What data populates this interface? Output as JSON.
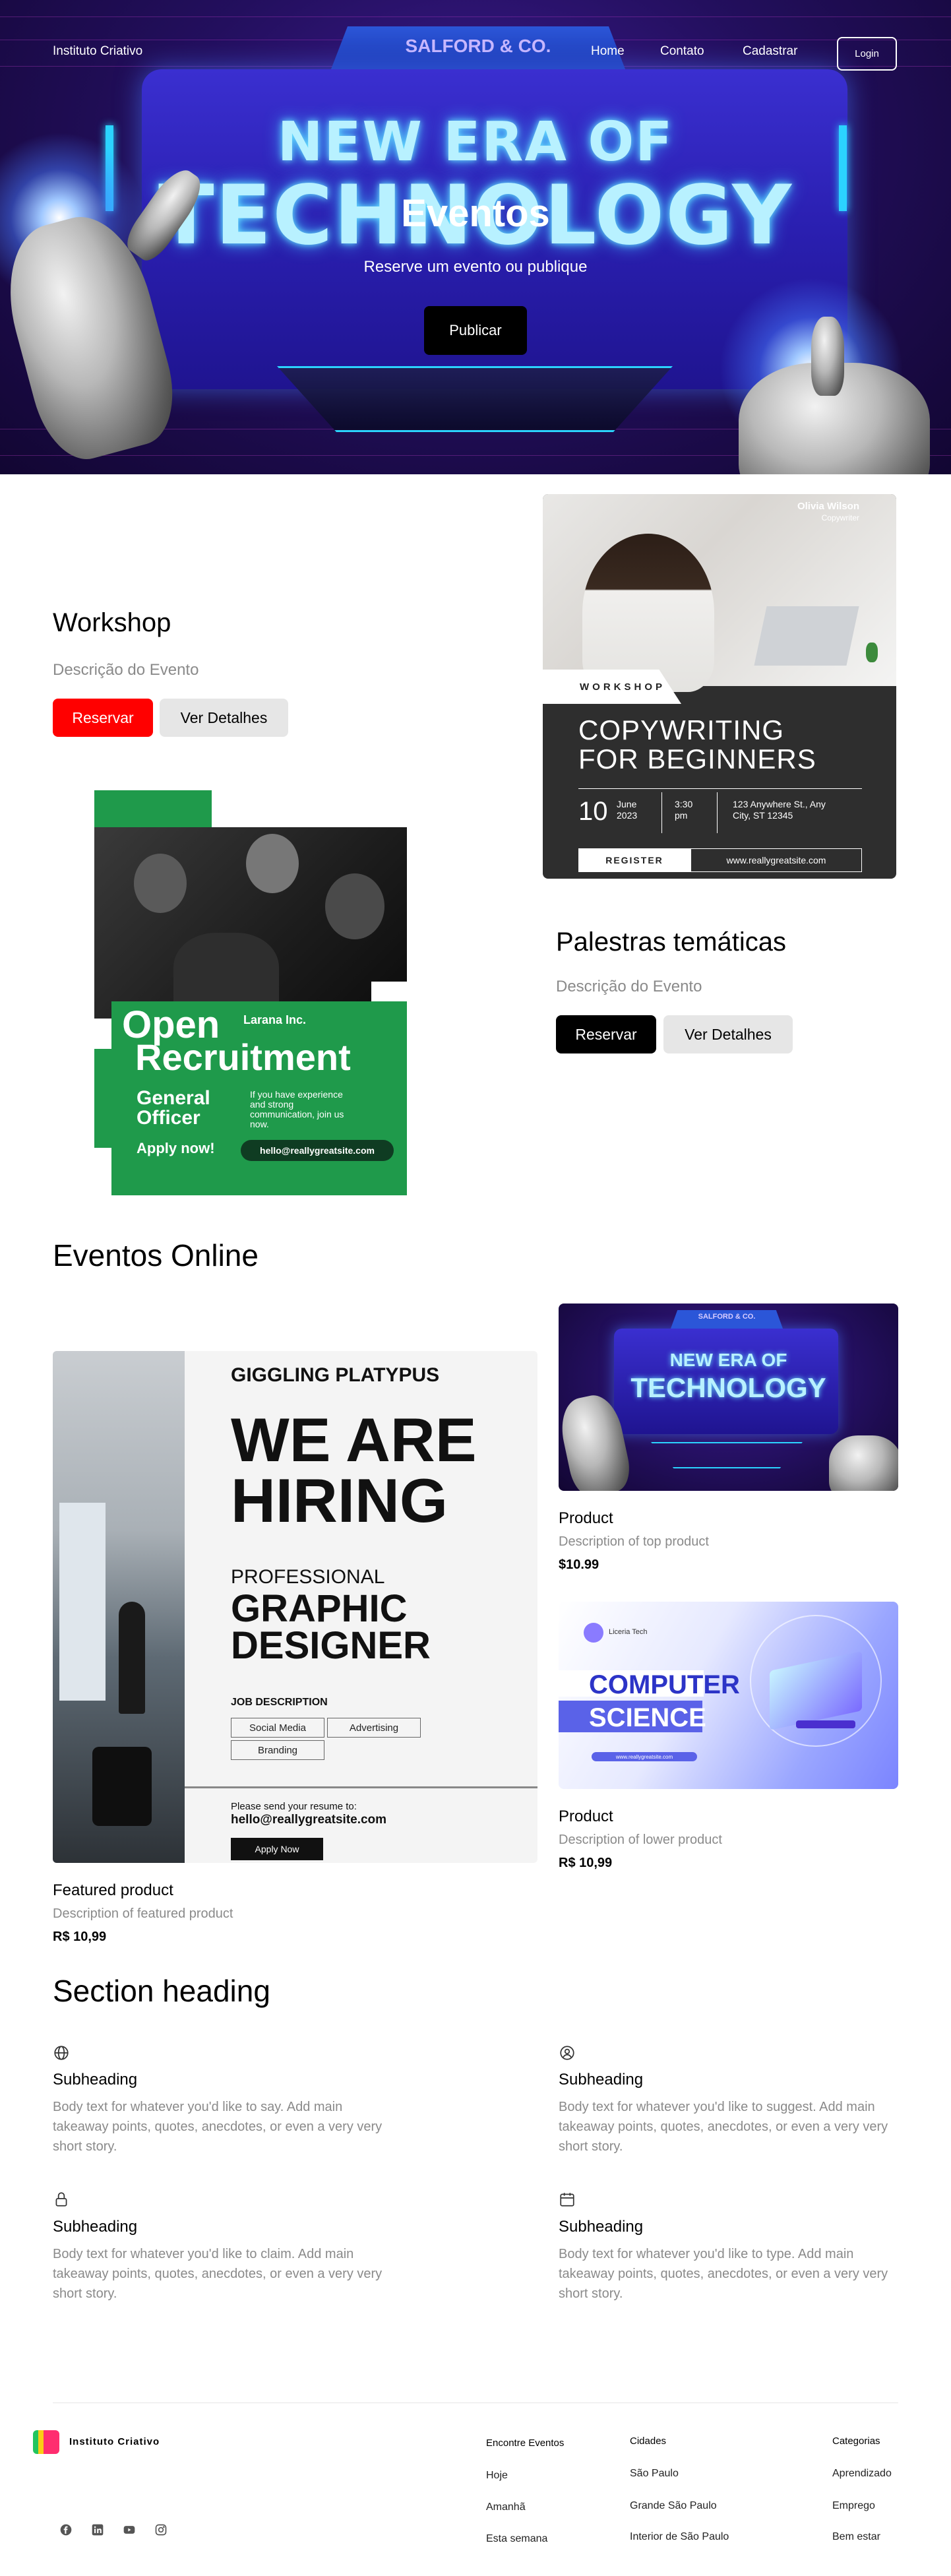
{
  "hero": {
    "brand": "Instituto Criativo",
    "nav": [
      "Home",
      "Contato",
      "Cadastrar"
    ],
    "login": "Login",
    "banner_company": "SALFORD & CO.",
    "banner_line1": "NEW ERA OF",
    "banner_line2": "TECHNOLOGY",
    "title": "Eventos",
    "subtitle": "Reserve um evento ou publique",
    "publish": "Publicar"
  },
  "workshop": {
    "title": "Workshop",
    "description": "Descrição do Evento",
    "reserve": "Reservar",
    "details": "Ver Detalhes",
    "poster": {
      "name": "Olivia Wilson",
      "role": "Copywriter",
      "tag": "WORKSHOP",
      "title_line1": "COPYWRITING",
      "title_line2": "FOR BEGINNERS",
      "day": "10",
      "month_year": "June\n2023",
      "time": "3:30\npm",
      "address": "123 Anywhere St., Any\nCity, ST 12345",
      "register": "REGISTER",
      "website": "www.reallygreatsite.com"
    }
  },
  "palestras": {
    "title": "Palestras temáticas",
    "description": "Descrição do Evento",
    "reserve": "Reservar",
    "details": "Ver Detalhes",
    "poster": {
      "company": "Larana Inc.",
      "line1": "Open",
      "line2": "Recruitment",
      "role_line1": "General",
      "role_line2": "Officer",
      "info": "If you have experience\nand strong\ncommunication, join us\nnow.",
      "apply": "Apply now!",
      "email": "hello@reallygreatsite.com"
    }
  },
  "online": {
    "title": "Eventos Online",
    "featured": {
      "poster": {
        "company": "GIGGLING PLATYPUS",
        "headline1": "WE ARE",
        "headline2": "HIRING",
        "professional": "PROFESSIONAL",
        "role1": "GRAPHIC",
        "role2": "DESIGNER",
        "job_desc": "JOB DESCRIPTION",
        "tags": [
          "Social Media",
          "Advertising",
          "Branding"
        ],
        "send": "Please send your resume to:",
        "email": "hello@reallygreatsite.com",
        "apply": "Apply Now"
      },
      "name": "Featured product",
      "description": "Description of featured product",
      "price": "R$ 10,99"
    },
    "top": {
      "poster": {
        "company": "SALFORD & CO.",
        "line1": "NEW ERA OF",
        "line2": "TECHNOLOGY"
      },
      "name": "Product",
      "description": "Description of top product",
      "price": "$10.99"
    },
    "lower": {
      "poster": {
        "company": "Liceria Tech",
        "line1": "COMPUTER",
        "line2": "SCIENCE",
        "website": "www.reallygreatsite.com"
      },
      "name": "Product",
      "description": "Description of lower product",
      "price": "R$ 10,99"
    }
  },
  "features": {
    "heading": "Section heading",
    "items": [
      {
        "icon": "globe-icon",
        "title": "Subheading",
        "body": "Body text for whatever you'd like to say. Add main takeaway points, quotes, anecdotes, or even a very very short story."
      },
      {
        "icon": "user-circle-icon",
        "title": "Subheading",
        "body": "Body text for whatever you'd like to suggest. Add main takeaway points, quotes, anecdotes, or even a very very short story."
      },
      {
        "icon": "lock-icon",
        "title": "Subheading",
        "body": "Body text for whatever you'd like to claim. Add main takeaway points, quotes, anecdotes, or even a very very short story."
      },
      {
        "icon": "calendar-icon",
        "title": "Subheading",
        "body": "Body text for whatever you'd like to type. Add main takeaway points, quotes, anecdotes, or even a very very short story."
      }
    ]
  },
  "footer": {
    "brand": "Instituto Criativo",
    "columns": [
      {
        "title": "Encontre Eventos",
        "links": [
          "Hoje",
          "Amanhã",
          "Esta semana"
        ]
      },
      {
        "title": "Cidades",
        "links": [
          "São Paulo",
          "Grande São Paulo",
          "Interior de São Paulo"
        ]
      },
      {
        "title": "Categorias",
        "links": [
          "Aprendizado",
          "Emprego",
          "Bem estar"
        ]
      }
    ],
    "social_icons": [
      "facebook-icon",
      "linkedin-icon",
      "youtube-icon",
      "instagram-icon"
    ]
  },
  "colors": {
    "accent_red": "#ff0000",
    "recruit_green": "#1f9a4b",
    "hero_purple": "#2a1fb0"
  }
}
